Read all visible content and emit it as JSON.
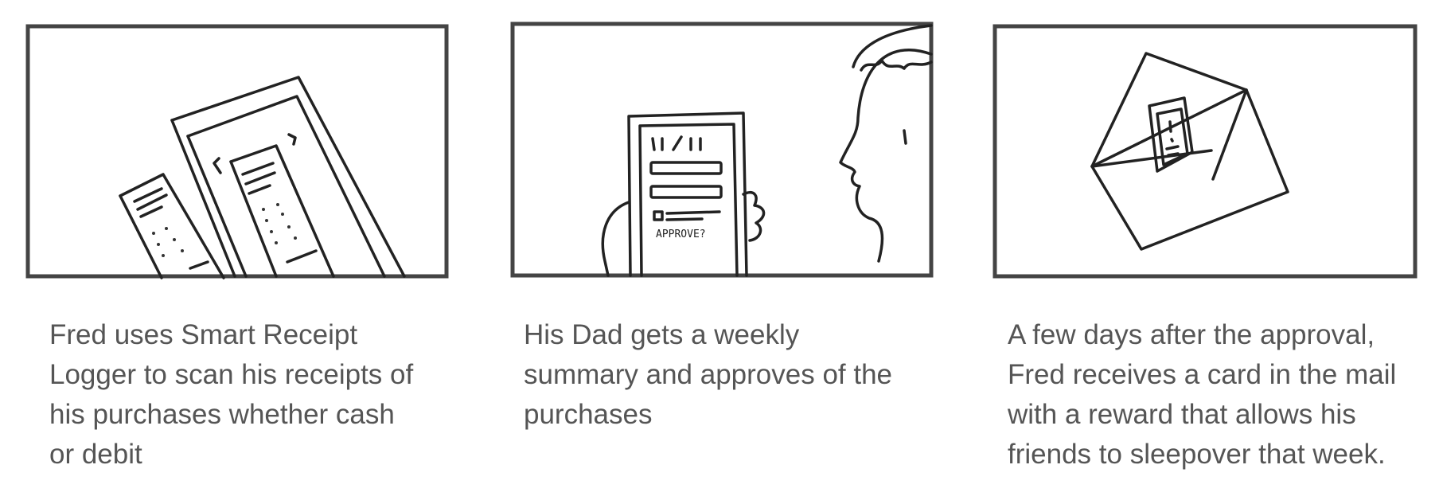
{
  "storyboard": {
    "panels": [
      {
        "id": "scan",
        "illustration": "receipts-icon",
        "caption": "Fred uses Smart Receipt Logger to scan his receipts of his purchases whether cash or debit"
      },
      {
        "id": "approve",
        "illustration": "phone-approve-icon",
        "screen_text": "APPROVE?",
        "caption": "His Dad gets a weekly summary and approves of the purchases"
      },
      {
        "id": "reward",
        "illustration": "envelope-card-icon",
        "caption": "A few days after the approval, Fred receives a card in the mail with a reward that allows his friends to sleepover that week."
      }
    ]
  },
  "colors": {
    "caption_text": "#555555",
    "frame_stroke": "#444444",
    "ink": "#222222"
  }
}
